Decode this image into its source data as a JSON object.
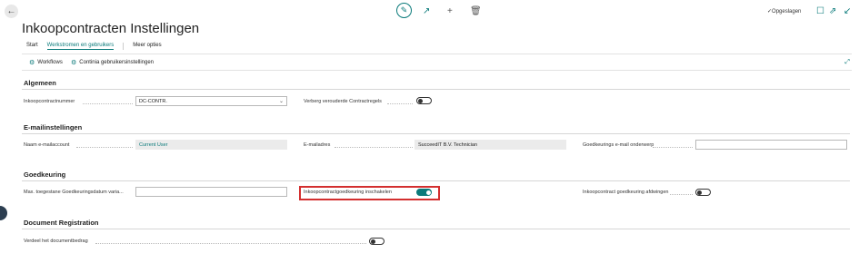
{
  "header": {
    "back_icon": "arrow-left-icon",
    "edit_icon": "pencil-icon",
    "share_icon": "share-icon",
    "new_icon": "plus-icon",
    "delete_icon": "trash-icon",
    "saved_label": "Opgeslagen",
    "bookmark_icon": "bookmark-icon",
    "popout_icon": "open-in-new-window-icon",
    "collapse_icon": "collapse-icon"
  },
  "page": {
    "title": "Inkoopcontracten Instellingen"
  },
  "tabs": [
    {
      "label": "Start"
    },
    {
      "label": "Werkstromen en gebruikers",
      "active": true
    },
    {
      "label": "Meer opties"
    }
  ],
  "actions": [
    {
      "label": "Workflows",
      "icon": "workflow-icon"
    },
    {
      "label": "Continia gebruikersinstellingen",
      "icon": "user-settings-icon"
    }
  ],
  "sections": {
    "algemeen": {
      "title": "Algemeen",
      "contract_nr_label": "Inkoopcontractnummer",
      "contract_nr_value": "DC-CONTR.",
      "hide_old_label": "Verberg verouderde Contractregels",
      "hide_old_on": false
    },
    "email": {
      "title": "E-mailinstellingen",
      "account_label": "Naam e-mailaccount",
      "account_value": "Current User",
      "address_label": "E-mailadres",
      "address_value": "SucceedIT B.V. Technician",
      "subject_label": "Goedkeurings e-mail onderwerp",
      "subject_value": ""
    },
    "goedkeuring": {
      "title": "Goedkeuring",
      "max_date_label": "Max. toegestane Goedkeuringsdatum varia...",
      "max_date_value": "",
      "enable_label": "Inkoopcontractgoedkeuring inschakelen",
      "enable_on": true,
      "enforce_label": "Inkoopcontract goedkeuring afdwingen",
      "enforce_on": false
    },
    "document": {
      "title": "Document Registration",
      "split_label": "Verdeel het documentbedrag",
      "split_on": false
    }
  },
  "colors": {
    "accent": "#0a7a7a",
    "highlight": "#d32f2f"
  }
}
